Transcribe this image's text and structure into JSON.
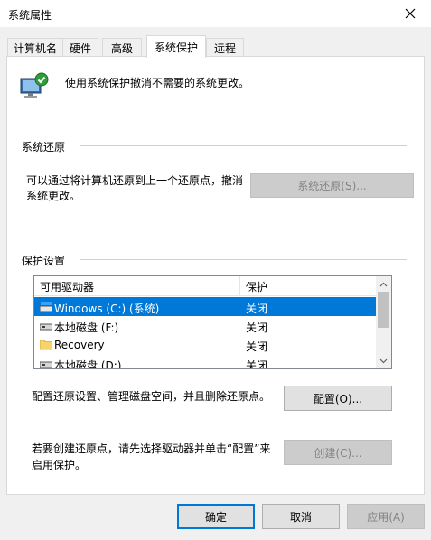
{
  "window": {
    "title": "系统属性"
  },
  "tabs": [
    {
      "label": "计算机名"
    },
    {
      "label": "硬件"
    },
    {
      "label": "高级"
    },
    {
      "label": "系统保护"
    },
    {
      "label": "远程"
    }
  ],
  "header": {
    "description": "使用系统保护撤消不需要的系统更改。"
  },
  "restore": {
    "group_title": "系统还原",
    "text_line1": "可以通过将计算机还原到上一个还原点，撤消",
    "text_line2": "系统更改。",
    "button_label": "系统还原(S)..."
  },
  "protection": {
    "group_title": "保护设置",
    "columns": [
      "可用驱动器",
      "保护"
    ],
    "drives": [
      {
        "name": "Windows (C:) (系统)",
        "protection": "关闭",
        "icon": "system-drive-icon"
      },
      {
        "name": "本地磁盘 (F:)",
        "protection": "关闭",
        "icon": "hard-drive-icon"
      },
      {
        "name": "Recovery",
        "protection": "关闭",
        "icon": "folder-icon"
      },
      {
        "name": "本地磁盘 (D:)",
        "protection": "关闭",
        "icon": "hard-drive-icon"
      }
    ],
    "configure_text": "配置还原设置、管理磁盘空间，并且删除还原点。",
    "configure_button": "配置(O)...",
    "create_text_line1": "若要创建还原点，请先选择驱动器并单击“配置”来",
    "create_text_line2": "启用保护。",
    "create_button": "创建(C)..."
  },
  "footer": {
    "ok": "确定",
    "cancel": "取消",
    "apply": "应用(A)"
  },
  "colors": {
    "accent": "#0078d7",
    "selection": "#0078d7"
  }
}
